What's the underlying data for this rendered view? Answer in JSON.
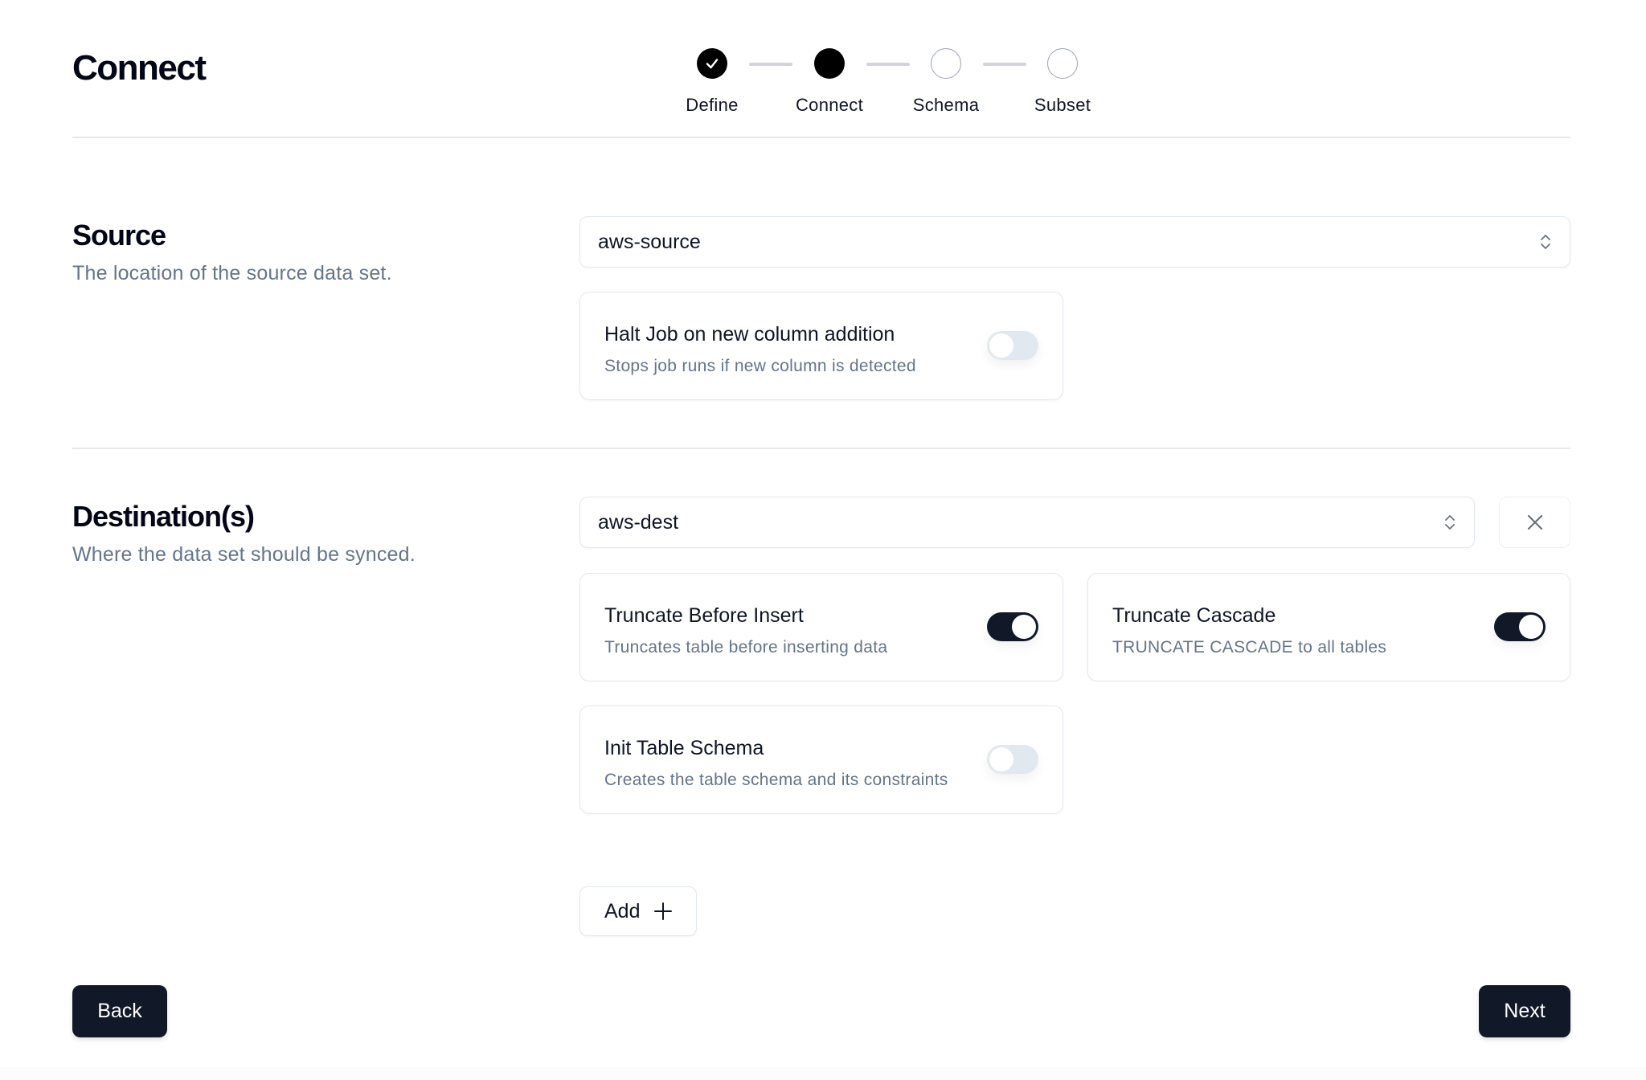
{
  "page": {
    "title": "Connect"
  },
  "stepper": {
    "steps": [
      {
        "label": "Define",
        "state": "complete"
      },
      {
        "label": "Connect",
        "state": "current"
      },
      {
        "label": "Schema",
        "state": "upcoming"
      },
      {
        "label": "Subset",
        "state": "upcoming"
      }
    ]
  },
  "source": {
    "title": "Source",
    "description": "The location of the source data set.",
    "selected": "aws-source",
    "options": [
      {
        "title": "Halt Job on new column addition",
        "description": "Stops job runs if new column is detected",
        "enabled": false
      }
    ]
  },
  "destinations": {
    "title": "Destination(s)",
    "description": "Where the data set should be synced.",
    "selected": "aws-dest",
    "options": [
      {
        "title": "Truncate Before Insert",
        "description": "Truncates table before inserting data",
        "enabled": true
      },
      {
        "title": "Truncate Cascade",
        "description": "TRUNCATE CASCADE to all tables",
        "enabled": true
      },
      {
        "title": "Init Table Schema",
        "description": "Creates the table schema and its constraints",
        "enabled": false
      }
    ],
    "add_label": "Add"
  },
  "footer": {
    "back_label": "Back",
    "next_label": "Next"
  },
  "colors": {
    "primary": "#111827",
    "muted_text": "#64748b",
    "border": "#e2e8f0",
    "toggle_off": "#e2e8f0"
  }
}
